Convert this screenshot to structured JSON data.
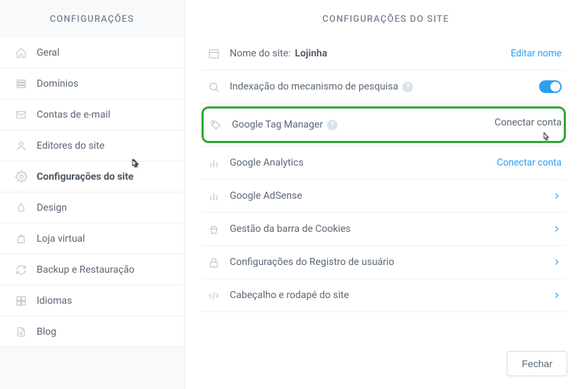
{
  "sidebar": {
    "title": "CONFIGURAÇÕES",
    "items": [
      {
        "label": "Geral"
      },
      {
        "label": "Domínios"
      },
      {
        "label": "Contas de e-mail"
      },
      {
        "label": "Editores do site"
      },
      {
        "label": "Configurações do site"
      },
      {
        "label": "Design"
      },
      {
        "label": "Loja virtual"
      },
      {
        "label": "Backup e Restauração"
      },
      {
        "label": "Idiomas"
      },
      {
        "label": "Blog"
      }
    ]
  },
  "main": {
    "title": "CONFIGURAÇÕES DO SITE",
    "site_name_label": "Nome do site:",
    "site_name_value": "Lojinha",
    "edit_name": "Editar nome",
    "rows": {
      "search_indexing": "Indexação do mecanismo de pesquisa",
      "gtm": "Google Tag Manager",
      "gtm_connect": "Conectar conta",
      "ga": "Google Analytics",
      "ga_connect": "Conectar conta",
      "adsense": "Google AdSense",
      "cookies": "Gestão da barra de Cookies",
      "user_reg": "Configurações do Registro de usuário",
      "header_footer": "Cabeçalho e rodapé do site"
    },
    "close": "Fechar"
  }
}
